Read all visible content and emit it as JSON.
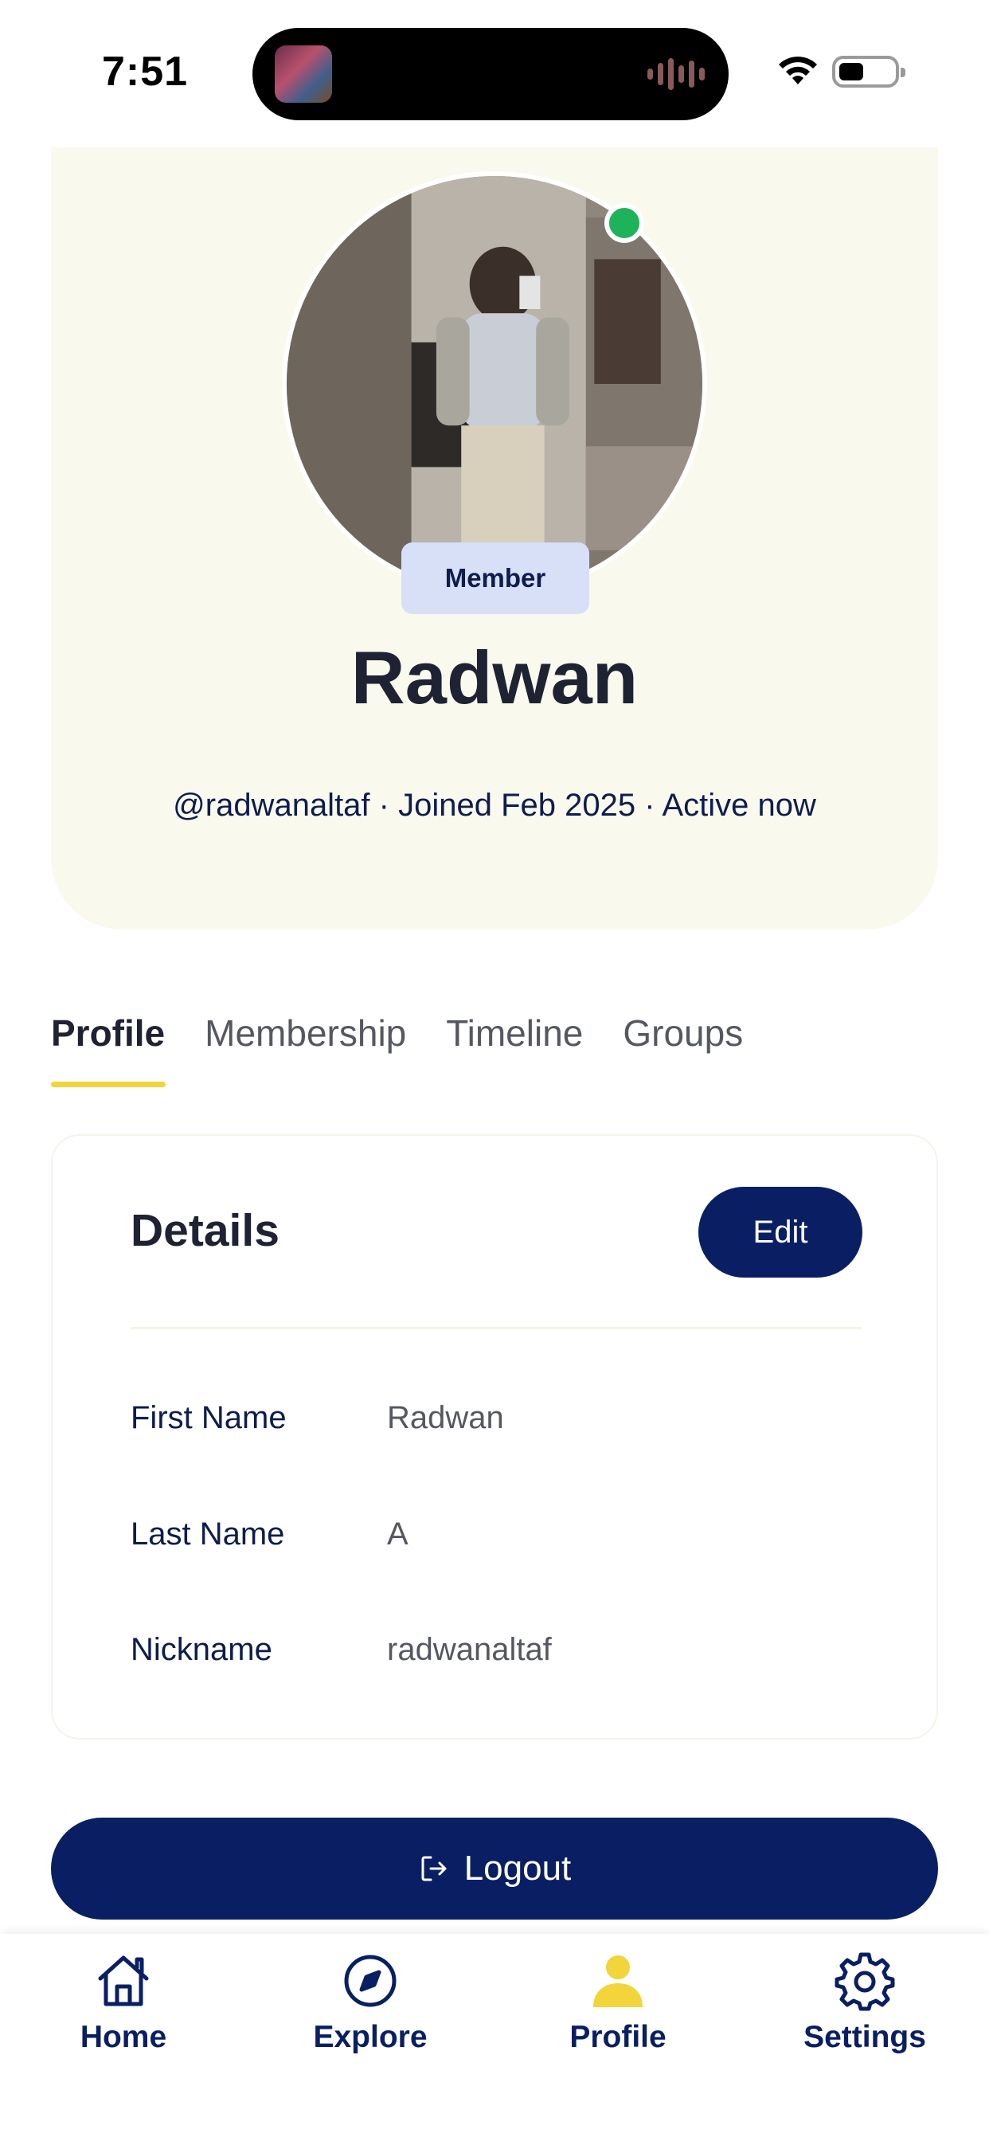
{
  "status_bar": {
    "time": "7:51"
  },
  "profile": {
    "badge": "Member",
    "name": "Radwan",
    "meta": "@radwanaltaf · Joined Feb 2025 · Active now"
  },
  "tabs": [
    {
      "label": "Profile",
      "active": true
    },
    {
      "label": "Membership",
      "active": false
    },
    {
      "label": "Timeline",
      "active": false
    },
    {
      "label": "Groups",
      "active": false
    }
  ],
  "details": {
    "title": "Details",
    "edit_label": "Edit",
    "rows": [
      {
        "label": "First Name",
        "value": "Radwan"
      },
      {
        "label": "Last Name",
        "value": "A"
      },
      {
        "label": "Nickname",
        "value": "radwanaltaf"
      }
    ]
  },
  "logout": {
    "label": "Logout",
    "icon": "logout-icon"
  },
  "bottom_nav": [
    {
      "label": "Home",
      "icon": "home-icon",
      "active": false
    },
    {
      "label": "Explore",
      "icon": "compass-icon",
      "active": false
    },
    {
      "label": "Profile",
      "icon": "person-icon",
      "active": true
    },
    {
      "label": "Settings",
      "icon": "gear-icon",
      "active": false
    }
  ],
  "colors": {
    "primary": "#0a1f63",
    "accent": "#f2d43b",
    "hero_bg": "#f9f9ee",
    "online": "#1eb25a",
    "badge_bg": "#d8e0f7"
  }
}
